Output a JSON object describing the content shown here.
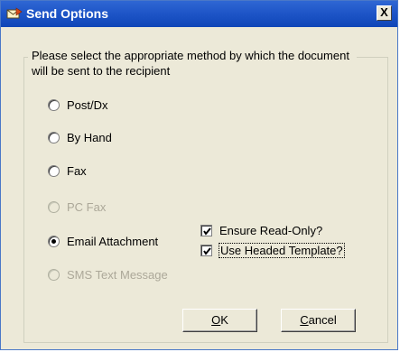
{
  "window": {
    "title": "Send Options",
    "close_glyph": "X",
    "icon": "send-mail-icon"
  },
  "group": {
    "caption": "Please select the appropriate method by which the document will be sent to the recipient"
  },
  "options": [
    {
      "label": "Post/Dx",
      "checked": false,
      "enabled": true
    },
    {
      "label": "By Hand",
      "checked": false,
      "enabled": true
    },
    {
      "label": "Fax",
      "checked": false,
      "enabled": true
    },
    {
      "label": "PC Fax",
      "checked": false,
      "enabled": false
    },
    {
      "label": "Email Attachment",
      "checked": true,
      "enabled": true
    },
    {
      "label": "SMS Text Message",
      "checked": false,
      "enabled": false
    }
  ],
  "email_options": [
    {
      "label": "Ensure Read-Only?",
      "checked": true
    },
    {
      "label": "Use Headed Template?",
      "checked": true,
      "focused": true
    }
  ],
  "buttons": {
    "ok": {
      "mnemonic": "O",
      "rest": "K"
    },
    "cancel": {
      "mnemonic": "C",
      "rest": "ancel"
    }
  },
  "colors": {
    "titlebar": "#1f56c8",
    "dialog_bg": "#ece9d8",
    "disabled_text": "#aca899"
  }
}
